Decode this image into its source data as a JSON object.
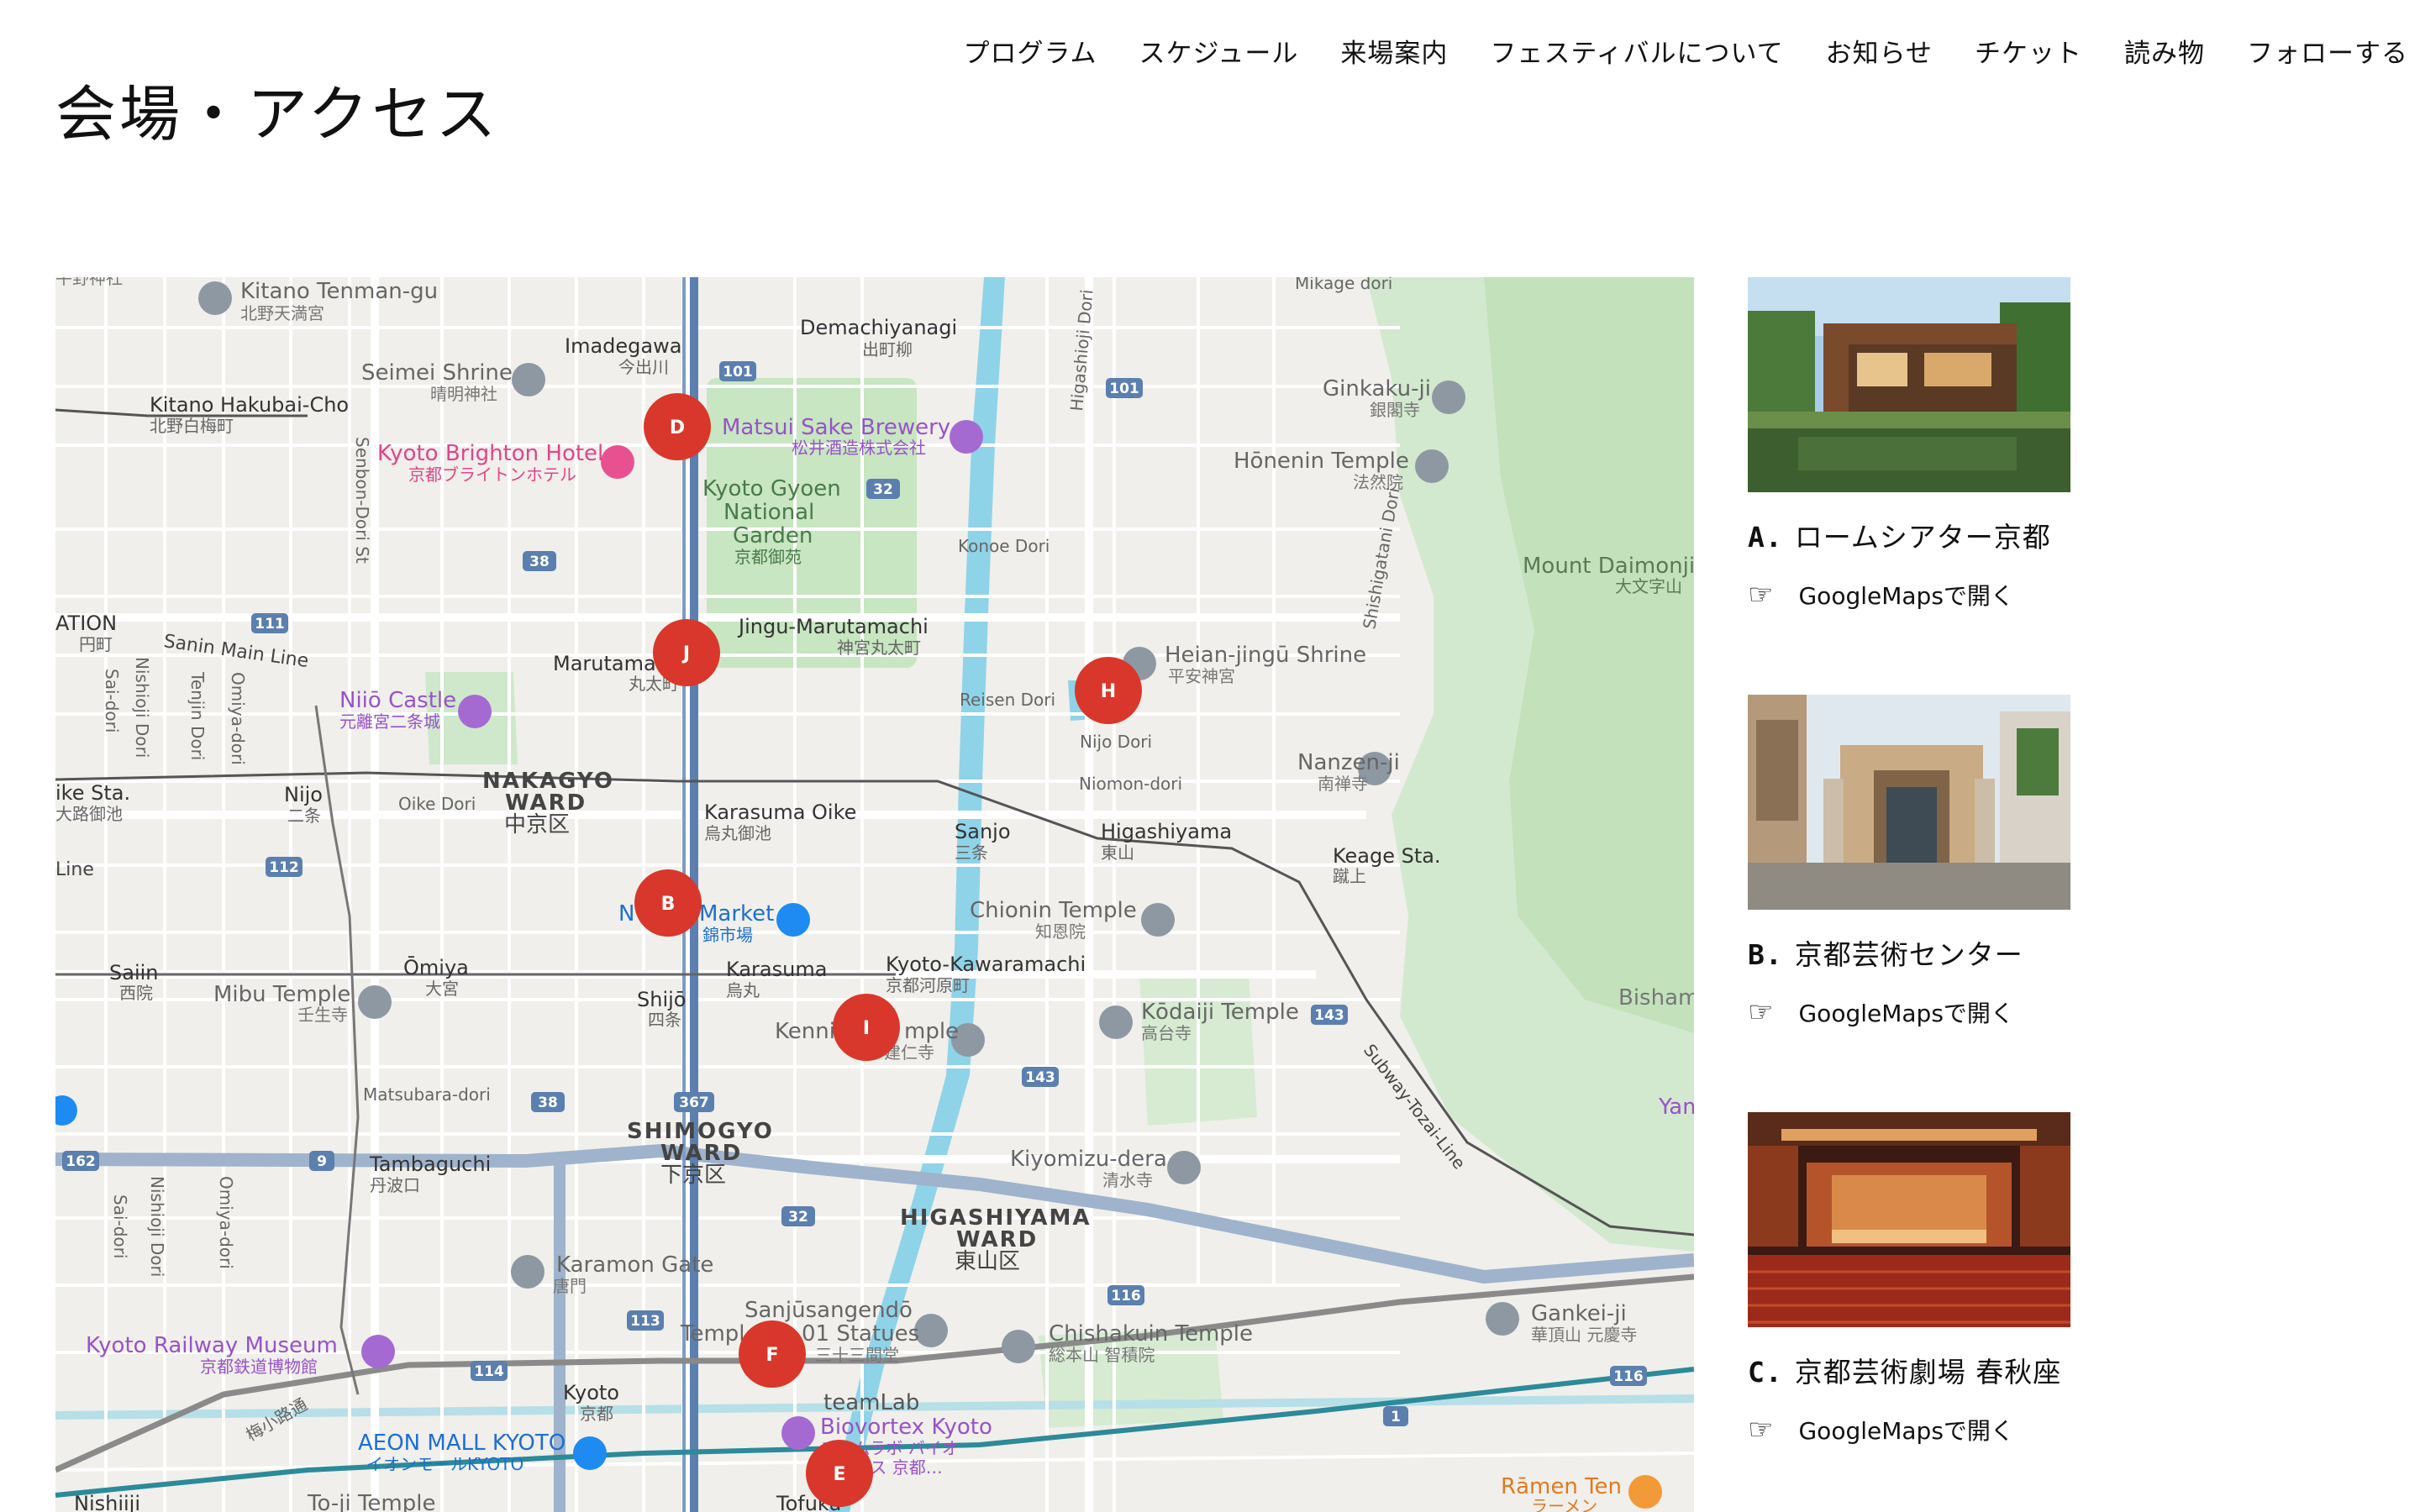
{
  "nav": {
    "items": [
      "プログラム",
      "スケジュール",
      "来場案内",
      "フェスティバルについて",
      "お知らせ",
      "チケット",
      "読み物",
      "フォローする"
    ]
  },
  "page": {
    "title": "会場・アクセス"
  },
  "map": {
    "markers": [
      "D",
      "J",
      "H",
      "B",
      "I",
      "F",
      "E"
    ],
    "places": {
      "kitano_tenman_gu": "Kitano Tenman-gu",
      "kitano_tenman_gu_jp": "北野天満宮",
      "hirano_jinja_jp": "平野神社",
      "mikage_dori": "Mikage dori",
      "demachiyanagi": "Demachiyanagi",
      "demachiyanagi_jp": "出町柳",
      "imadegawa": "Imadegawa",
      "imadegawa_jp": "今出川",
      "seimei_shrine": "Seimei Shrine",
      "seimei_shrine_jp": "晴明神社",
      "kitano_hakubai_cho": "Kitano Hakubai-Cho",
      "kitano_hakubai_cho_jp": "北野白梅町",
      "kyoto_brighton_hotel": "Kyoto Brighton Hotel",
      "kyoto_brighton_hotel_jp": "京都ブライトンホテル",
      "matsui_sake_brewery": "Matsui Sake Brewery",
      "matsui_sake_brewery_jp": "松井酒造株式会社",
      "ginkaku_ji": "Ginkaku-ji",
      "ginkaku_ji_jp": "銀閣寺",
      "honenin_temple": "Hōnenin Temple",
      "honenin_temple_jp": "法然院",
      "senbon_dori": "Senbon-Dori St",
      "gyoen_1": "Kyoto Gyoen",
      "gyoen_2": "National",
      "gyoen_3": "Garden",
      "gyoen_jp": "京都御苑",
      "higashioji_dori": "Higashioji Dori",
      "shishigatani_dori": "Shishigatani Dori",
      "konoe_dori": "Konoe Dori",
      "mount_daimonji": "Mount Daimonji",
      "mount_daimonji_jp": "大文字山",
      "station_partial": "ATION",
      "enmachi_jp": "円町",
      "sanin_main_line": "Sanin Main Line",
      "jingu_marutamachi": "Jingu-Marutamachi",
      "jingu_marutamachi_jp": "神宮丸太町",
      "heian_jingu_shrine": "Heian-jingū Shrine",
      "heian_jingu_shrine_jp": "平安神宮",
      "marutamachi": "Marutamachi",
      "marutamachi_jp": "丸太町",
      "nishioji_dori": "Nishioji Dori",
      "sai_dori": "Sai-dori",
      "tenjin_dori": "Tenjin Dori",
      "omiya_dori": "Omiya-dori",
      "nijo_castle": "Niiō Castle",
      "nijo_castle_jp": "元離宮二条城",
      "reisen_dori": "Reisen Dori",
      "nijo_dori": "Nijo Dori",
      "nanzen_ji": "Nanzen-ji",
      "nanzen_ji_jp": "南禅寺",
      "niomon_dori": "Niomon-dori",
      "nakagyo_1": "NAKAGYO",
      "nakagyo_2": "WARD",
      "nakagyo_jp": "中京区",
      "nijo": "Nijo",
      "nijo_jp": "二条",
      "oike_dori": "Oike Dori",
      "ike_sta": "ike Sta.",
      "ike_sta_jp": "大路御池",
      "karasuma_oike": "Karasuma Oike",
      "karasuma_oike_jp": "烏丸御池",
      "sanjo": "Sanjo",
      "sanjo_jp": "三条",
      "higashiyama": "Higashiyama",
      "higashiyama_jp": "東山",
      "keage_sta": "Keage Sta.",
      "keage_sta_jp": "蹴上",
      "line_partial": "Line",
      "chionin_temple": "Chionin Temple",
      "chionin_temple_jp": "知恩院",
      "market": "Market",
      "market_prefix": "N",
      "market_jp": "錦市場",
      "saiin": "Saiin",
      "saiin_jp": "西院",
      "omiya": "Ōmiya",
      "omiya_jp": "大宮",
      "karasuma": "Karasuma",
      "karasuma_jp": "烏丸",
      "kyoto_kawaramachi": "Kyoto-Kawaramachi",
      "kyoto_kawaramachi_jp": "京都河原町",
      "mibu_temple": "Mibu Temple",
      "mibu_temple_jp": "壬生寺",
      "shijo": "Shijō",
      "shijo_jp": "四条",
      "kennin_temple_a": "Kenni",
      "kennin_temple_b": "mple",
      "kennin_temple_jp": "建仁寺",
      "kodaiji_temple": "Kōdaiji Temple",
      "kodaiji_temple_jp": "高台寺",
      "bisham": "Bisham",
      "matsubara_dori": "Matsubara-dori",
      "subway_tozai_line": "Subway-Tozai-Line",
      "shimogyo_1": "SHIMOGYO",
      "shimogyo_2": "WARD",
      "shimogyo_jp": "下京区",
      "tambaguchi": "Tambaguchi",
      "tambaguchi_jp": "丹波口",
      "kiyomizu_dera": "Kiyomizu-dera",
      "kiyomizu_dera_jp": "清水寺",
      "yam": "Yam",
      "higashiyama_ward_1": "HIGASHIYAMA",
      "higashiyama_ward_2": "WARD",
      "higashiyama_ward_jp": "東山区",
      "karamon_gate": "Karamon Gate",
      "karamon_gate_jp": "唐門",
      "sanjusangendo": "Sanjūsangendō",
      "temple_1001_a": "Templ",
      "temple_1001_b": "01 Statues",
      "temple_1001_jp": "三十三間堂",
      "chishakuin_temple": "Chishakuin Temple",
      "chishakuin_temple_jp": "総本山 智積院",
      "gankei_ji": "Gankei-ji",
      "gankei_ji_jp": "華頂山 元慶寺",
      "kyoto_railway_museum": "Kyoto Railway Museum",
      "kyoto_railway_museum_jp": "京都鉄道博物館",
      "kyoto": "Kyoto",
      "kyoto_jp": "京都",
      "umekoji_dori": "梅小路通",
      "teamlab": "teamLab",
      "biovortex": "Biovortex Kyoto",
      "biovortex_jp": "チームラボ バイオ",
      "biovortex_jp2": "テックス 京都…",
      "aeon_mall": "AEON MALL KYOTO",
      "aeon_mall_jp": "イオンモールKYOTO",
      "nishiiji": "Nishiiji",
      "toji_temple": "To-ji Temple",
      "tofukuji": "Tofuku",
      "ramen_ten": "Rāmen Ten",
      "ramen_ten_jp": "ラーメン",
      "r101a": "101",
      "r101b": "101",
      "r32a": "32",
      "r38a": "38",
      "r111": "111",
      "r112": "112",
      "r9": "9",
      "r162": "162",
      "r38b": "38",
      "r367": "367",
      "r143a": "143",
      "r143b": "143",
      "r32b": "32",
      "r113": "113",
      "r114": "114",
      "r116a": "116",
      "r116b": "116",
      "r1": "1"
    }
  },
  "venues": [
    {
      "letter": "A.",
      "name": "ロームシアター京都",
      "link": "GoogleMapsで開く",
      "image": "exterior-building-photo"
    },
    {
      "letter": "B.",
      "name": "京都芸術センター",
      "link": "GoogleMapsで開く",
      "image": "gate-building-photo"
    },
    {
      "letter": "C.",
      "name": "京都芸術劇場 春秋座",
      "link": "GoogleMapsで開く",
      "image": "theater-interior-photo"
    }
  ],
  "icons": {
    "link_hand": "pointing-hand-icon",
    "marker_color": "#d9372b",
    "map_water": "#8fd3e8",
    "map_park": "#c8e6c0",
    "map_rail": "#5b7fae"
  }
}
